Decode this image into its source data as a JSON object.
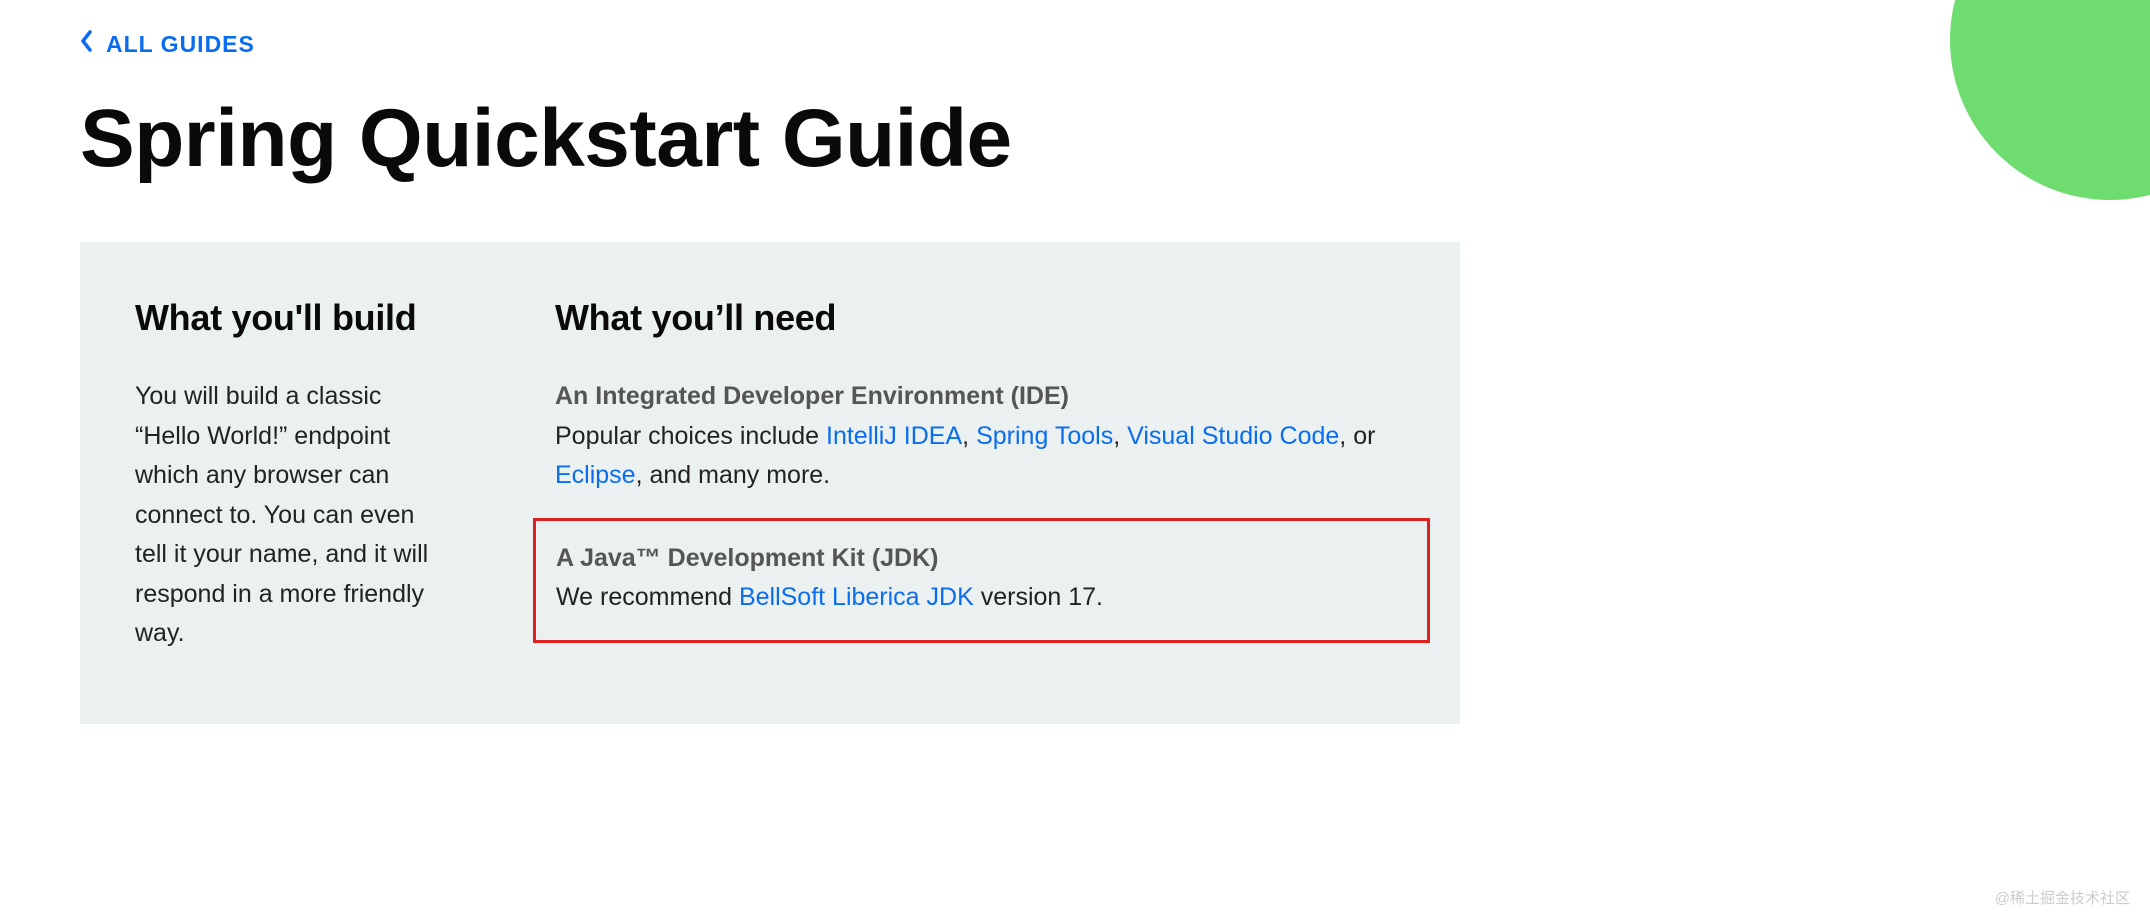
{
  "nav": {
    "back_label": "ALL GUIDES"
  },
  "page": {
    "title": "Spring Quickstart Guide"
  },
  "build": {
    "heading": "What you'll build",
    "text": "You will build a classic “Hello World!” endpoint which any browser can connect to. You can even tell it your name, and it will respond in a more friendly way."
  },
  "need": {
    "heading": "What you’ll need",
    "ide": {
      "title": "An Integrated Developer Environment (IDE)",
      "prefix": "Popular choices include ",
      "links": {
        "intellij": "IntelliJ IDEA",
        "spring_tools": "Spring Tools",
        "vscode": "Visual Studio Code",
        "eclipse": "Eclipse"
      },
      "sep1": ", ",
      "sep2": ", ",
      "sep3": ", or ",
      "suffix": ", and many more."
    },
    "jdk": {
      "title": "A Java™ Development Kit (JDK)",
      "prefix": "We recommend ",
      "link": "BellSoft Liberica JDK",
      "suffix": " version 17."
    }
  },
  "watermark": "@稀土掘金技术社区"
}
